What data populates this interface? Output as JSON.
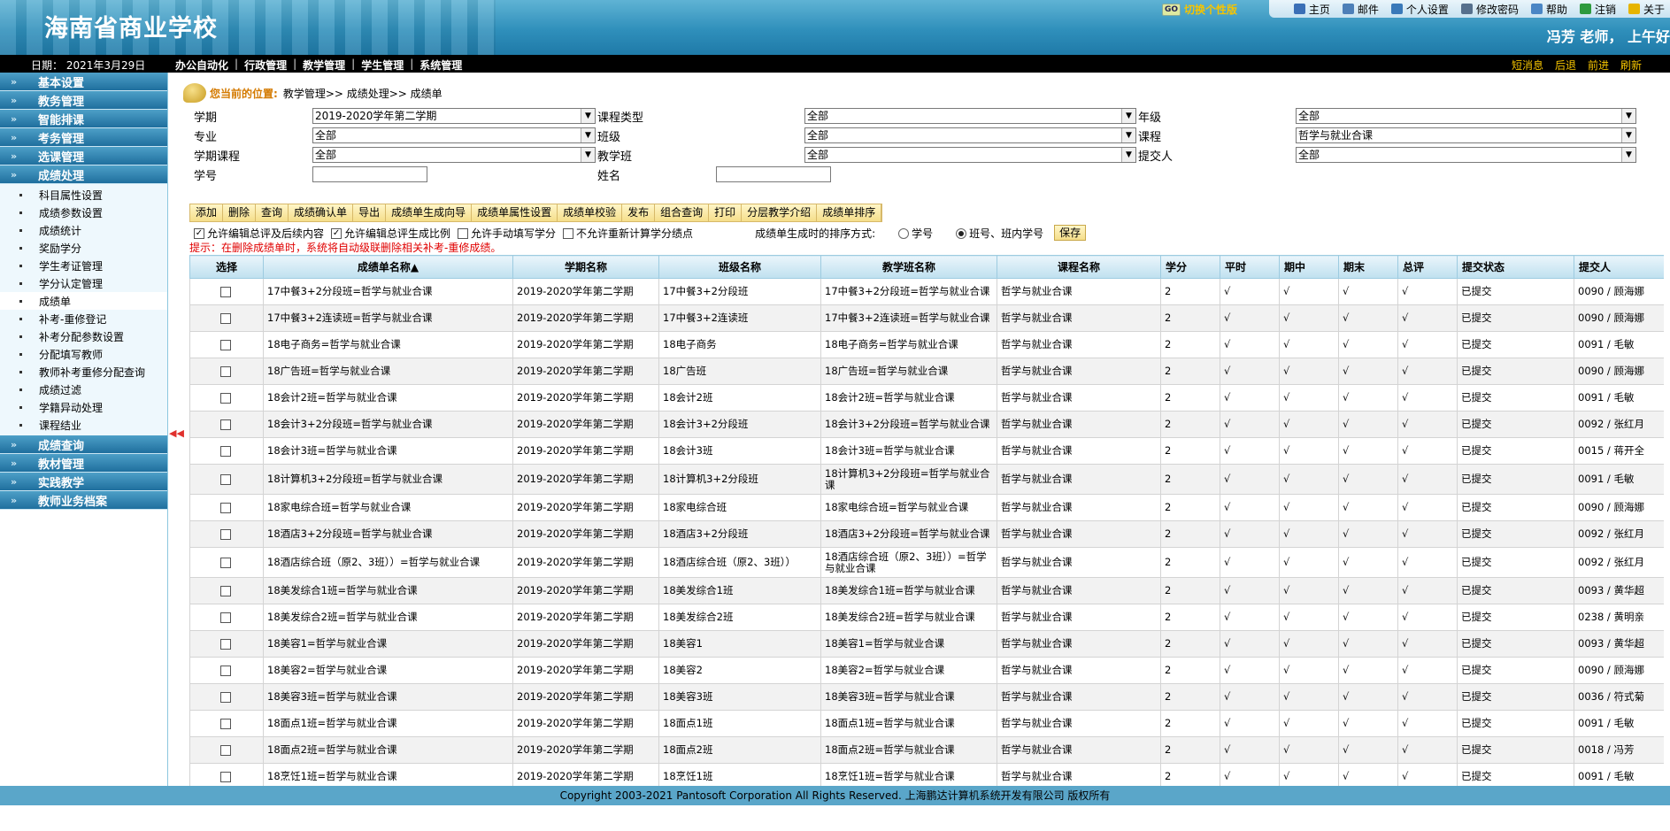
{
  "header": {
    "school_name": "海南省商业学校",
    "profile_switch": "切换个性版",
    "go_badge": "GO",
    "greeting": "冯芳  老师，  上午好",
    "top_links": [
      {
        "label": "主页",
        "icon": "home-icon",
        "color": "#3b6fb6"
      },
      {
        "label": "邮件",
        "icon": "mail-icon",
        "color": "#4d7fb8"
      },
      {
        "label": "个人设置",
        "icon": "user-icon",
        "color": "#3a79b9"
      },
      {
        "label": "修改密码",
        "icon": "key-icon",
        "color": "#56708d"
      },
      {
        "label": "帮助",
        "icon": "pin-icon",
        "color": "#4a86c5"
      },
      {
        "label": "注销",
        "icon": "leaf-icon",
        "color": "#2e9a3e"
      },
      {
        "label": "关于",
        "icon": "info-icon",
        "color": "#e6b400"
      }
    ]
  },
  "menubar": {
    "date": "日期：  2021年3月29日",
    "items": [
      "办公自动化",
      "行政管理",
      "教学管理",
      "学生管理",
      "系统管理"
    ],
    "separator": "|",
    "right_links": [
      "短消息",
      "后退",
      "前进",
      "刷新"
    ]
  },
  "sidebar": {
    "sections_top": [
      "基本设置",
      "教务管理",
      "智能排课",
      "考务管理",
      "选课管理",
      "成绩处理"
    ],
    "sub_items": [
      "科目属性设置",
      "成绩参数设置",
      "成绩统计",
      "奖励学分",
      "学生考证管理",
      "学分认定管理",
      "成绩单",
      "补考-重修登记",
      "补考分配参数设置",
      "分配填写教师",
      "教师补考重修分配查询",
      "成绩过滤",
      "学籍异动处理",
      "课程结业"
    ],
    "active_sub": 6,
    "sections_bottom": [
      "成绩查询",
      "教材管理",
      "实践教学",
      "教师业务档案"
    ],
    "collapse": "◀◀"
  },
  "breadcrumb": {
    "label": "您当前的位置:",
    "path": "教学管理>> 成绩处理>> 成绩单"
  },
  "filters": {
    "term_label": "学期",
    "term_value": "2019-2020学年第二学期",
    "course_type_label": "课程类型",
    "course_type_value": "全部",
    "grade_label": "年级",
    "grade_value": "全部",
    "major_label": "专业",
    "major_value": "全部",
    "class_label": "班级",
    "class_value": "全部",
    "course_label": "课程",
    "course_value": "哲学与就业合课",
    "term_course_label": "学期课程",
    "term_course_value": "全部",
    "teach_class_label": "教学班",
    "teach_class_value": "全部",
    "submitter_label": "提交人",
    "submitter_value": "全部",
    "student_no_label": "学号",
    "student_no_value": "",
    "name_label": "姓名",
    "name_value": ""
  },
  "toolbar": [
    "添加",
    "删除",
    "查询",
    "成绩确认单",
    "导出",
    "成绩单生成向导",
    "成绩单属性设置",
    "成绩单校验",
    "发布",
    "组合查询",
    "打印",
    "分层教学介绍",
    "成绩单排序"
  ],
  "options": {
    "allow_total_edit": "允许编辑总评及后续内容",
    "allow_ratio_edit": "允许编辑总评生成比例",
    "allow_manual_credit": "允许手动填写学分",
    "no_recalc": "不允许重新计算学分绩点",
    "sort_label": "成绩单生成时的排序方式:",
    "sort_by_no": "学号",
    "sort_by_class": "班号、班内学号",
    "save": "保存"
  },
  "tip": "提示：在删除成绩单时，系统将自动级联删除相关补考-重修成绩。",
  "table": {
    "headers": [
      "选择",
      "成绩单名称▲",
      "学期名称",
      "班级名称",
      "教学班名称",
      "课程名称",
      "学分",
      "平时",
      "期中",
      "期末",
      "总评",
      "提交状态",
      "提交人"
    ],
    "rows": [
      [
        "17中餐3+2分段班=哲学与就业合课",
        "2019-2020学年第二学期",
        "17中餐3+2分段班",
        "17中餐3+2分段班=哲学与就业合课",
        "哲学与就业合课",
        "2",
        "√",
        "√",
        "√",
        "√",
        "已提交",
        "0090 / 顾海娜"
      ],
      [
        "17中餐3+2连读班=哲学与就业合课",
        "2019-2020学年第二学期",
        "17中餐3+2连读班",
        "17中餐3+2连读班=哲学与就业合课",
        "哲学与就业合课",
        "2",
        "√",
        "√",
        "√",
        "√",
        "已提交",
        "0090 / 顾海娜"
      ],
      [
        "18电子商务=哲学与就业合课",
        "2019-2020学年第二学期",
        "18电子商务",
        "18电子商务=哲学与就业合课",
        "哲学与就业合课",
        "2",
        "√",
        "√",
        "√",
        "√",
        "已提交",
        "0091 / 毛敏"
      ],
      [
        "18广告班=哲学与就业合课",
        "2019-2020学年第二学期",
        "18广告班",
        "18广告班=哲学与就业合课",
        "哲学与就业合课",
        "2",
        "√",
        "√",
        "√",
        "√",
        "已提交",
        "0090 / 顾海娜"
      ],
      [
        "18会计2班=哲学与就业合课",
        "2019-2020学年第二学期",
        "18会计2班",
        "18会计2班=哲学与就业合课",
        "哲学与就业合课",
        "2",
        "√",
        "√",
        "√",
        "√",
        "已提交",
        "0091 / 毛敏"
      ],
      [
        "18会计3+2分段班=哲学与就业合课",
        "2019-2020学年第二学期",
        "18会计3+2分段班",
        "18会计3+2分段班=哲学与就业合课",
        "哲学与就业合课",
        "2",
        "√",
        "√",
        "√",
        "√",
        "已提交",
        "0092 / 张红月"
      ],
      [
        "18会计3班=哲学与就业合课",
        "2019-2020学年第二学期",
        "18会计3班",
        "18会计3班=哲学与就业合课",
        "哲学与就业合课",
        "2",
        "√",
        "√",
        "√",
        "√",
        "已提交",
        "0015 / 蒋开全"
      ],
      [
        "18计算机3+2分段班=哲学与就业合课",
        "2019-2020学年第二学期",
        "18计算机3+2分段班",
        "18计算机3+2分段班=哲学与就业合课",
        "哲学与就业合课",
        "2",
        "√",
        "√",
        "√",
        "√",
        "已提交",
        "0091 / 毛敏"
      ],
      [
        "18家电综合班=哲学与就业合课",
        "2019-2020学年第二学期",
        "18家电综合班",
        "18家电综合班=哲学与就业合课",
        "哲学与就业合课",
        "2",
        "√",
        "√",
        "√",
        "√",
        "已提交",
        "0090 / 顾海娜"
      ],
      [
        "18酒店3+2分段班=哲学与就业合课",
        "2019-2020学年第二学期",
        "18酒店3+2分段班",
        "18酒店3+2分段班=哲学与就业合课",
        "哲学与就业合课",
        "2",
        "√",
        "√",
        "√",
        "√",
        "已提交",
        "0092 / 张红月"
      ],
      [
        "18酒店综合班（原2、3班））=哲学与就业合课",
        "2019-2020学年第二学期",
        "18酒店综合班（原2、3班））",
        "18酒店综合班（原2、3班））=哲学与就业合课",
        "哲学与就业合课",
        "2",
        "√",
        "√",
        "√",
        "√",
        "已提交",
        "0092 / 张红月"
      ],
      [
        "18美发综合1班=哲学与就业合课",
        "2019-2020学年第二学期",
        "18美发综合1班",
        "18美发综合1班=哲学与就业合课",
        "哲学与就业合课",
        "2",
        "√",
        "√",
        "√",
        "√",
        "已提交",
        "0093 / 黄华超"
      ],
      [
        "18美发综合2班=哲学与就业合课",
        "2019-2020学年第二学期",
        "18美发综合2班",
        "18美发综合2班=哲学与就业合课",
        "哲学与就业合课",
        "2",
        "√",
        "√",
        "√",
        "√",
        "已提交",
        "0238 / 黄明亲"
      ],
      [
        "18美容1=哲学与就业合课",
        "2019-2020学年第二学期",
        "18美容1",
        "18美容1=哲学与就业合课",
        "哲学与就业合课",
        "2",
        "√",
        "√",
        "√",
        "√",
        "已提交",
        "0093 / 黄华超"
      ],
      [
        "18美容2=哲学与就业合课",
        "2019-2020学年第二学期",
        "18美容2",
        "18美容2=哲学与就业合课",
        "哲学与就业合课",
        "2",
        "√",
        "√",
        "√",
        "√",
        "已提交",
        "0090 / 顾海娜"
      ],
      [
        "18美容3班=哲学与就业合课",
        "2019-2020学年第二学期",
        "18美容3班",
        "18美容3班=哲学与就业合课",
        "哲学与就业合课",
        "2",
        "√",
        "√",
        "√",
        "√",
        "已提交",
        "0036 / 符式菊"
      ],
      [
        "18面点1班=哲学与就业合课",
        "2019-2020学年第二学期",
        "18面点1班",
        "18面点1班=哲学与就业合课",
        "哲学与就业合课",
        "2",
        "√",
        "√",
        "√",
        "√",
        "已提交",
        "0091 / 毛敏"
      ],
      [
        "18面点2班=哲学与就业合课",
        "2019-2020学年第二学期",
        "18面点2班",
        "18面点2班=哲学与就业合课",
        "哲学与就业合课",
        "2",
        "√",
        "√",
        "√",
        "√",
        "已提交",
        "0018 / 冯芳"
      ],
      [
        "18烹饪1班=哲学与就业合课",
        "2019-2020学年第二学期",
        "18烹饪1班",
        "18烹饪1班=哲学与就业合课",
        "哲学与就业合课",
        "2",
        "√",
        "√",
        "√",
        "√",
        "已提交",
        "0091 / 毛敏"
      ]
    ]
  },
  "footer": "Copyright 2003-2021 Pantosoft Corporation All Rights Reserved.  上海鹏达计算机系统开发有限公司   版权所有"
}
